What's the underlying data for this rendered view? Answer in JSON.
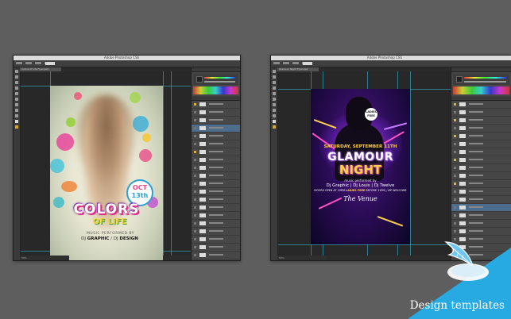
{
  "windows": [
    {
      "id": "w1",
      "title": "Adobe Photoshop CS6",
      "tab": "Colors of Life Flyer.psd",
      "status": "50%"
    },
    {
      "id": "w2",
      "title": "Adobe Photoshop CS6",
      "tab": "Glamour Night Flyer.psd",
      "status": "50%"
    }
  ],
  "poster1": {
    "date_month": "OCT",
    "date_day": "13th",
    "headline": "COLORS",
    "subheadline": "OF LIFE",
    "music_line": "MUSIC PERFORMED BY",
    "dj_a_prefix": "DJ ",
    "dj_a": "GRAPHIC",
    "dj_sep": " / DJ ",
    "dj_b": "DESIGN"
  },
  "poster2": {
    "hat_badge": "LADIES FREE",
    "date_line": "SATURDAY, SEPTEMBER 11TH",
    "headline": "GLAMOUR",
    "subheadline": "NIGHT",
    "music_line": "music performed by",
    "djs": "Dj Graphic | Dj Louis | Dj Twelve",
    "doors_prefix": "DOORS OPEN AT 10PM",
    "doors_highlight": "LADIES FREE",
    "doors_suffix": "BEFORE 11PM | VIP WELCOME",
    "venue": "The Venue"
  },
  "badge": {
    "label": "Design templates",
    "icon": "feather-icon"
  },
  "colors": {
    "badge_blue": "#27a9e1",
    "background": "#5e5e5e",
    "guide": "#2fb9d6"
  }
}
